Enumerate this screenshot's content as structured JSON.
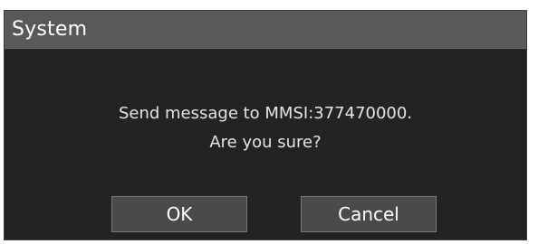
{
  "dialog": {
    "title": "System",
    "message_line1": "Send message to MMSI:377470000.",
    "message_line2": "Are you sure?",
    "buttons": {
      "ok_label": "OK",
      "cancel_label": "Cancel"
    }
  }
}
